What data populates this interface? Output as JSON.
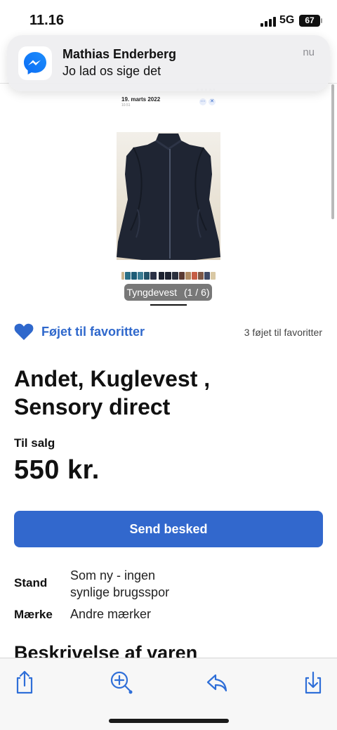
{
  "status_bar": {
    "time": "11.16",
    "network": "5G",
    "battery": "67"
  },
  "notification": {
    "app_icon": "messenger-icon",
    "sender": "Mathias Enderberg",
    "message": "Jo lad os sige det",
    "time": "nu"
  },
  "image": {
    "photo_date": "19. marts 2022",
    "photo_subtime": "10.51",
    "label": "Tyngdevest",
    "counter": "(1 / 6)"
  },
  "favorite": {
    "icon": "heart-icon",
    "label": "Føjet til favoritter",
    "count": "3 føjet til favoritter",
    "color": "#2f68cc"
  },
  "listing": {
    "title_line1": "Andet, Kuglevest ,",
    "title_line2": "Sensory direct",
    "sale_type": "Til salg",
    "price": "550 kr.",
    "send_button": "Send besked",
    "attributes": [
      {
        "label": "Stand",
        "value_line1": "Som ny - ingen",
        "value_line2": "synlige brugsspor"
      },
      {
        "label": "Mærke",
        "value_line1": "Andre mærker",
        "value_line2": ""
      }
    ],
    "description_title": "Beskrivelse af varen"
  },
  "toolbar": {
    "items": [
      "share-icon",
      "zoom-in-icon",
      "reply-icon",
      "download-icon"
    ],
    "accent": "#2f6fd8"
  }
}
